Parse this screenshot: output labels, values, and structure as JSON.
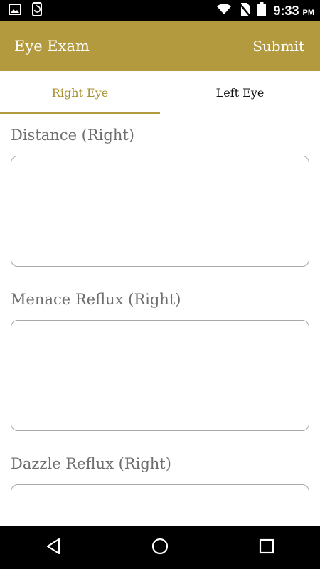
{
  "status_bar": {
    "time": "9:33",
    "ampm": "PM",
    "icons": [
      "gallery-icon",
      "sync-phone-icon",
      "wifi-icon",
      "no-sim-icon",
      "battery-icon"
    ]
  },
  "app_bar": {
    "title": "Eye Exam",
    "submit_label": "Submit",
    "background_color": "#b39a3e"
  },
  "tabs": [
    {
      "label": "Right Eye",
      "active": true
    },
    {
      "label": "Left Eye",
      "active": false
    }
  ],
  "fields": [
    {
      "label": "Distance (Right)",
      "value": ""
    },
    {
      "label": "Menace Reflux (Right)",
      "value": ""
    },
    {
      "label": "Dazzle Reflux (Right)",
      "value": ""
    }
  ],
  "nav_bar": {
    "icons": [
      "back-icon",
      "home-icon",
      "recents-icon"
    ]
  }
}
